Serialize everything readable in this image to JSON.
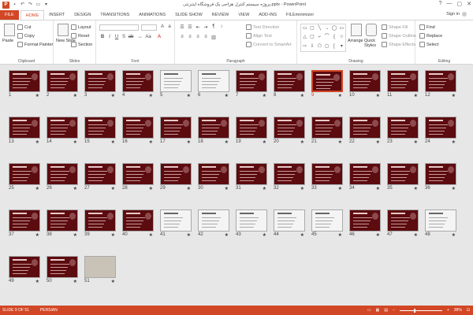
{
  "app": {
    "logo": "P",
    "title": "پروژه سیستم کنترل هزاحی یک فروشگاه اینترنتی.pptx - PowerPoint",
    "signin": "Sign in",
    "window_controls": [
      "?",
      "—",
      "▢",
      "✕"
    ]
  },
  "tabs": [
    "FILE",
    "HOME",
    "INSERT",
    "DESIGN",
    "TRANSITIONS",
    "ANIMATIONS",
    "SLIDE SHOW",
    "REVIEW",
    "VIEW",
    "ADD-INS",
    "FILEminimizer"
  ],
  "active_tab": "HOME",
  "ribbon": {
    "clipboard": {
      "label": "Clipboard",
      "paste": "Paste",
      "cut": "Cut",
      "copy": "Copy",
      "format_painter": "Format Painter"
    },
    "slides": {
      "label": "Slides",
      "new_slide": "New Slide",
      "layout": "Layout",
      "reset": "Reset",
      "section": "Section"
    },
    "font": {
      "label": "Font"
    },
    "paragraph": {
      "label": "Paragraph",
      "text_direction": "Text Direction",
      "align_text": "Align Text",
      "convert_smartart": "Convert to SmartArt"
    },
    "drawing": {
      "label": "Drawing",
      "arrange": "Arrange",
      "quick_styles": "Quick Styles",
      "shape_fill": "Shape Fill",
      "shape_outline": "Shape Outline",
      "shape_effects": "Shape Effects"
    },
    "editing": {
      "label": "Editing",
      "find": "Find",
      "replace": "Replace",
      "select": "Select"
    }
  },
  "slides": {
    "count": 51,
    "selected": 9,
    "white_slides": [
      5,
      6,
      41,
      42,
      43,
      44,
      45,
      48
    ],
    "photo_slides": [
      51
    ]
  },
  "status": {
    "slide_of": "SLIDE 9 OF 51",
    "language": "PERSIAN",
    "zoom": "38%"
  },
  "colors": {
    "accent": "#d24726",
    "slide_bg": "#5c0b0f"
  }
}
